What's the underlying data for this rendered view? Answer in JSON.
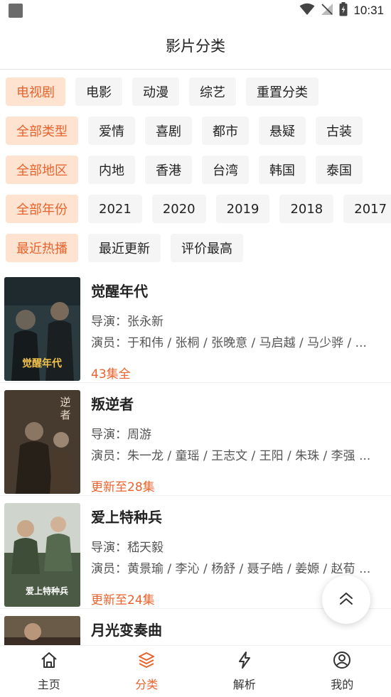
{
  "status_bar": {
    "time": "10:31"
  },
  "header": {
    "title": "影片分类"
  },
  "filters": [
    {
      "name": "category",
      "chips": [
        "电视剧",
        "电影",
        "动漫",
        "综艺",
        "重置分类"
      ],
      "active": 0
    },
    {
      "name": "type",
      "chips": [
        "全部类型",
        "爱情",
        "喜剧",
        "都市",
        "悬疑",
        "古装"
      ],
      "active": 0
    },
    {
      "name": "region",
      "chips": [
        "全部地区",
        "内地",
        "香港",
        "台湾",
        "韩国",
        "泰国"
      ],
      "active": 0
    },
    {
      "name": "year",
      "chips": [
        "全部年份",
        "2021",
        "2020",
        "2019",
        "2018",
        "2017"
      ],
      "active": 0
    },
    {
      "name": "sort",
      "chips": [
        "最近热播",
        "最近更新",
        "评价最高"
      ],
      "active": 0
    }
  ],
  "list": [
    {
      "title": "觉醒年代",
      "director": "导演：张永新",
      "cast": "演员：于和伟 / 张桐 / 张晚意 / 马启越 / 马少骅 / ...",
      "status": "43集全",
      "poster_text": "觉醒年代",
      "poster_color": "#2b3a3f"
    },
    {
      "title": "叛逆者",
      "director": "导演：周游",
      "cast": "演员：朱一龙 / 童瑶 / 王志文 / 王阳 / 朱珠 / 李强 ...",
      "status": "更新至28集",
      "poster_text": "逆者",
      "poster_color": "#3b3129"
    },
    {
      "title": "爱上特种兵",
      "director": "导演：嵇天毅",
      "cast": "演员：黄景瑜 / 李沁 / 杨舒 / 聂子皓 / 姜嫄 / 赵荀 ...",
      "status": "更新至24集",
      "poster_text": "爱上特种兵",
      "poster_color": "#4a5a45"
    },
    {
      "title": "月光变奏曲",
      "director": "",
      "cast": "",
      "status": "",
      "poster_text": "",
      "poster_color": "#3a2d26"
    }
  ],
  "fab": {
    "icon": "double-chevron-up-icon"
  },
  "tabbar": {
    "items": [
      {
        "label": "主页",
        "icon": "home-icon"
      },
      {
        "label": "分类",
        "icon": "layers-icon"
      },
      {
        "label": "解析",
        "icon": "lightning-icon"
      },
      {
        "label": "我的",
        "icon": "user-icon"
      }
    ],
    "active": 1
  },
  "colors": {
    "accent": "#e8632d",
    "chip_bg": "#f5f5f5",
    "chip_active_bg": "#fde3d0"
  }
}
